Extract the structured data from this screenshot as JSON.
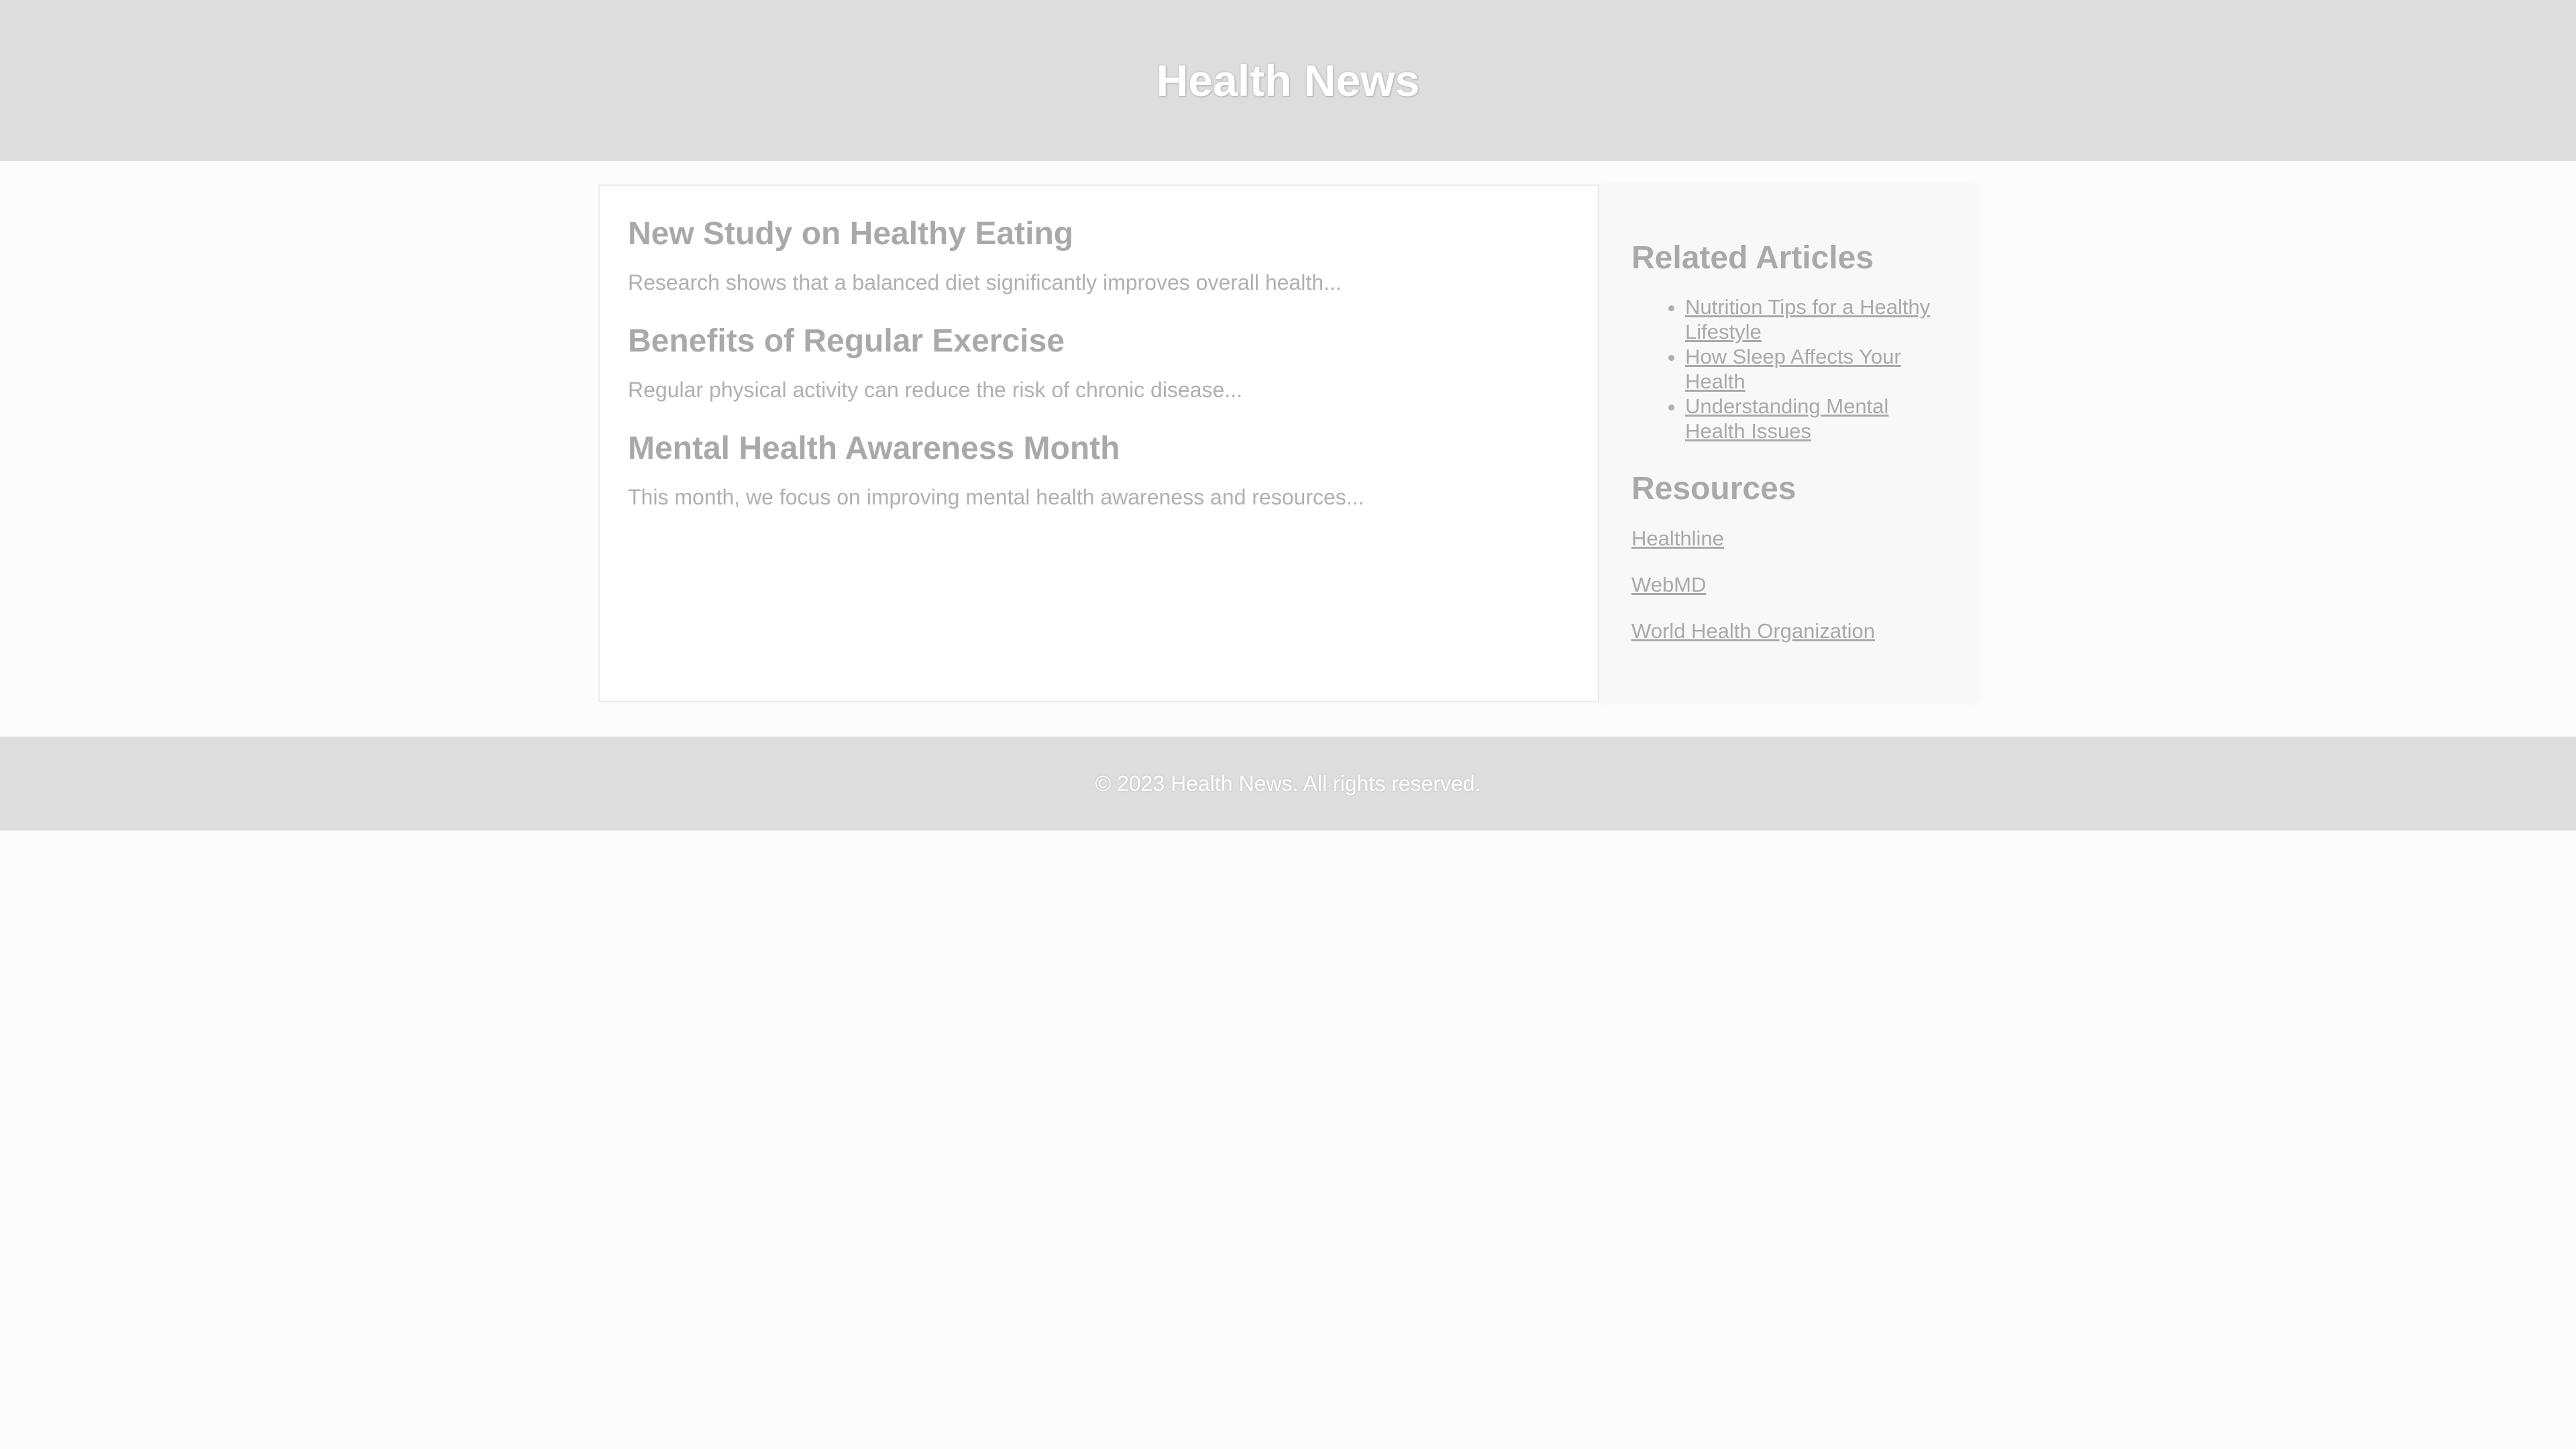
{
  "header": {
    "title": "Health News"
  },
  "main": {
    "articles": [
      {
        "title": "New Study on Healthy Eating",
        "summary": "Research shows that a balanced diet significantly improves overall health..."
      },
      {
        "title": "Benefits of Regular Exercise",
        "summary": "Regular physical activity can reduce the risk of chronic disease..."
      },
      {
        "title": "Mental Health Awareness Month",
        "summary": "This month, we focus on improving mental health awareness and resources..."
      }
    ]
  },
  "sidebar": {
    "related_title": "Related Articles",
    "related": [
      "Nutrition Tips for a Healthy Lifestyle",
      "How Sleep Affects Your Health",
      "Understanding Mental Health Issues"
    ],
    "resources_title": "Resources",
    "resources": [
      "Healthline",
      "WebMD",
      "World Health Organization"
    ]
  },
  "footer": {
    "text": "© 2023 Health News. All rights reserved."
  },
  "colors": {
    "header_bg": "#dddddd",
    "footer_bg": "#dddddd",
    "heading_text": "#a9a9a9",
    "body_text": "#b0b0b0"
  }
}
